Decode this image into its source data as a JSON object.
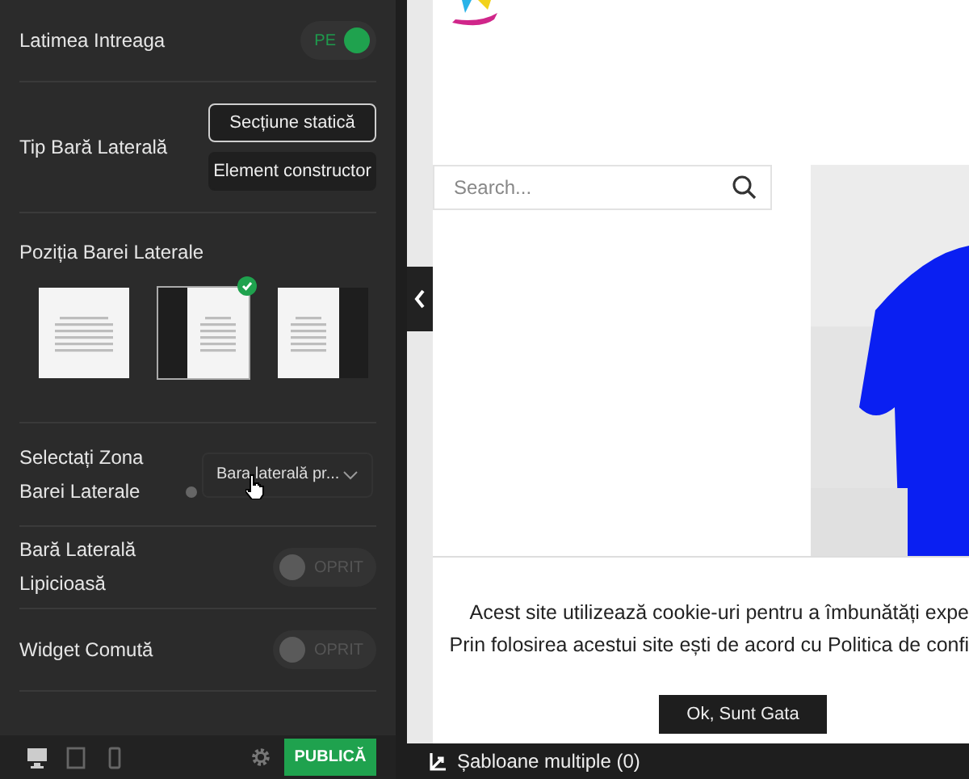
{
  "settings_panel": {
    "rows": [
      {
        "kind": "toggle",
        "label": "Latimea Intreaga",
        "on": true,
        "state_label": "PE"
      },
      {
        "kind": "choice",
        "label": "Tip Bară Laterală",
        "options": [
          {
            "label": "Secțiune statică",
            "selected": true
          },
          {
            "label": "Element constructor",
            "selected": false
          }
        ]
      },
      {
        "kind": "layouts",
        "label": "Poziția Barei Laterale",
        "options": [
          {
            "kind": "none",
            "selected": false
          },
          {
            "kind": "left",
            "selected": true
          },
          {
            "kind": "right",
            "selected": false
          }
        ]
      },
      {
        "kind": "select",
        "label": "Selectați Zona Barei Laterale",
        "value": "Bara laterală pr..."
      },
      {
        "kind": "toggle",
        "label": "Bară Laterală Lipicioasă",
        "on": false,
        "state_label": "OPRIT"
      },
      {
        "kind": "toggle",
        "label": "Widget Comută",
        "on": false,
        "state_label": "OPRIT"
      }
    ]
  },
  "footer": {
    "devices": [
      {
        "kind": "desktop",
        "selected": true
      },
      {
        "kind": "tablet",
        "selected": false
      },
      {
        "kind": "phone",
        "selected": false
      }
    ],
    "publish_button": "PUBLICĂ"
  },
  "preview": {
    "search": {
      "placeholder": "Search..."
    },
    "cookie_banner": {
      "lines": [
        "Acest site utilizează cookie-uri pentru a îmbunătăți expe",
        "Prin folosirea acestui site ești de acord cu Politica de confi"
      ],
      "button": "Ok, Sunt Gata"
    }
  },
  "bottom_bar": {
    "label": "Șabloane multiple (0)"
  }
}
